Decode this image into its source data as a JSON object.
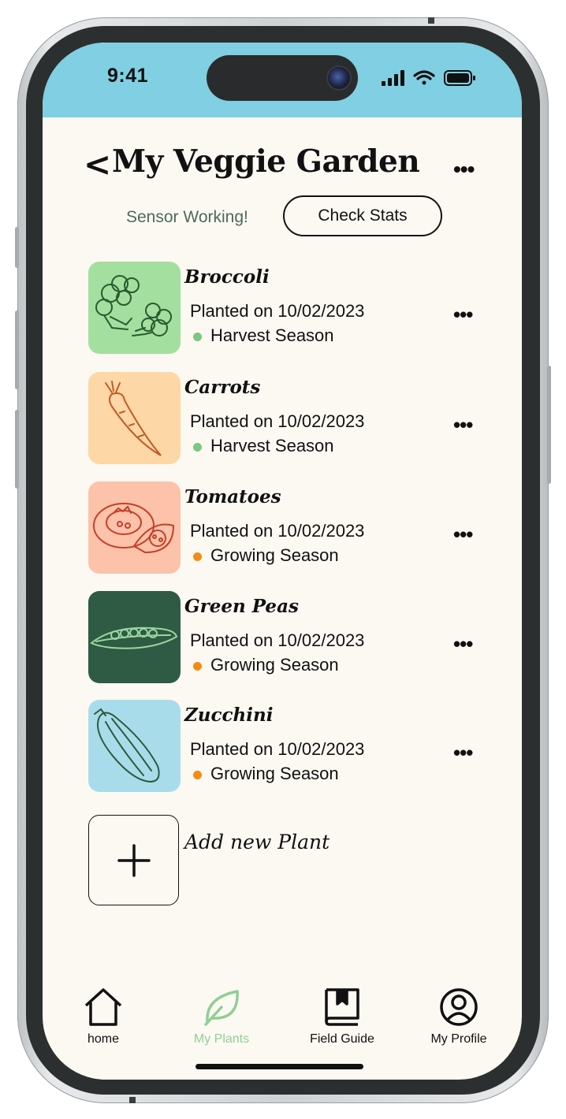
{
  "status_bar": {
    "time": "9:41"
  },
  "header": {
    "back_label": "<",
    "title": "My Veggie Garden",
    "more_label": "•••"
  },
  "sensor": {
    "status_text": "Sensor Working!",
    "check_button_label": "Check Stats"
  },
  "plants": [
    {
      "name": "Broccoli",
      "planted": "Planted on 10/02/2023",
      "season": "Harvest Season",
      "status_color": "#7cc77f",
      "tile_color": "#a3df9f",
      "icon": "broccoli-icon"
    },
    {
      "name": "Carrots",
      "planted": "Planted on 10/02/2023",
      "season": "Harvest Season",
      "status_color": "#7cc77f",
      "tile_color": "#fdd7a6",
      "icon": "carrot-icon"
    },
    {
      "name": "Tomatoes",
      "planted": "Planted on 10/02/2023",
      "season": "Growing Season",
      "status_color": "#f28c12",
      "tile_color": "#fcc2aa",
      "icon": "tomato-icon"
    },
    {
      "name": "Green Peas",
      "planted": "Planted on 10/02/2023",
      "season": "Growing Season",
      "status_color": "#f28c12",
      "tile_color": "#2f5a43",
      "icon": "pea-pod-icon"
    },
    {
      "name": "Zucchini",
      "planted": "Planted on 10/02/2023",
      "season": "Growing Season",
      "status_color": "#f28c12",
      "tile_color": "#a9dcea",
      "icon": "zucchini-icon"
    }
  ],
  "row_more_label": "•••",
  "add_plant": {
    "label": "Add new Plant",
    "icon": "plus-icon"
  },
  "nav": {
    "items": [
      {
        "label": "home",
        "icon": "home-icon",
        "active": false
      },
      {
        "label": "My Plants",
        "icon": "leaf-icon",
        "active": true
      },
      {
        "label": "Field Guide",
        "icon": "book-icon",
        "active": false
      },
      {
        "label": "My Profile",
        "icon": "profile-icon",
        "active": false
      }
    ],
    "active_color": "#8fcf95"
  },
  "colors": {
    "status_bar": "#80cfe2",
    "background": "#fcf9f2"
  }
}
